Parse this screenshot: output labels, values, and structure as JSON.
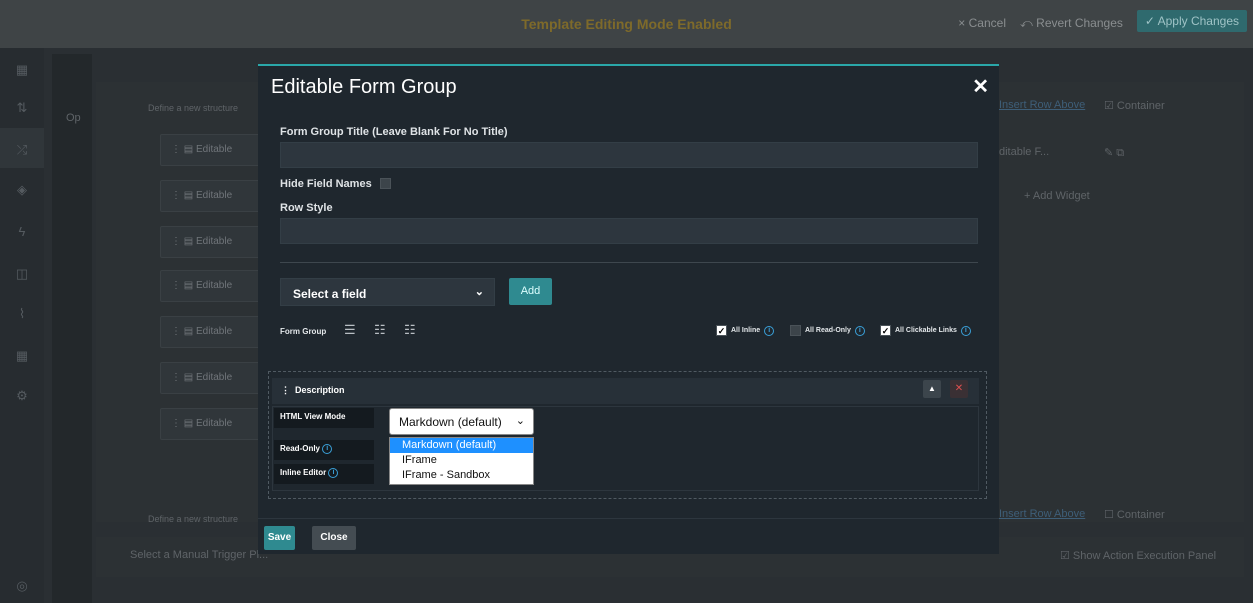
{
  "topbar": {
    "title": "Template Editing Mode Enabled",
    "cancel": "Cancel",
    "revert": "Revert Changes",
    "apply": "Apply Changes"
  },
  "background": {
    "define_structure": "Define a new structure",
    "op_label": "Op",
    "row_label": "Editable",
    "insert_row_above": "Insert Row Above",
    "container": "Container",
    "editable_f": "ditable F...",
    "add_widget": "+ Add Widget",
    "select_trigger": "Select a Manual Trigger Pl...",
    "show_action_panel": "Show Action Execution Panel"
  },
  "modal": {
    "title": "Editable Form Group",
    "group_title_label": "Form Group Title (Leave Blank For No Title)",
    "group_title_value": "",
    "hide_field_names": "Hide Field Names",
    "row_style_label": "Row Style",
    "row_style_value": "",
    "select_field": "Select a field",
    "add": "Add",
    "form_group_label": "Form Group",
    "all_inline": "All Inline",
    "all_read_only": "All Read-Only",
    "all_clickable_links": "All Clickable Links",
    "description": "Description",
    "html_view_mode": "HTML View Mode",
    "read_only": "Read-Only",
    "inline_editor": "Inline Editor",
    "selected_mode": "Markdown (default)",
    "mode_options": [
      "Markdown (default)",
      "IFrame",
      "IFrame - Sandbox"
    ],
    "save": "Save",
    "close": "Close"
  }
}
